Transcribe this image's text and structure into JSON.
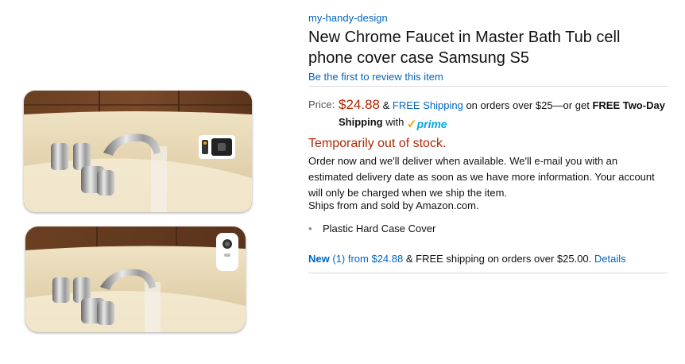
{
  "product": {
    "brand": "my-handy-design",
    "title": "New Chrome Faucet in Master Bath Tub cell phone cover case Samsung S5",
    "review_link": "Be the first to review this item",
    "images": [
      {
        "name": "samsung-s5-case-image"
      },
      {
        "name": "iphone-case-image"
      }
    ]
  },
  "price": {
    "label": "Price:",
    "amount": "$24.88",
    "amp": "&",
    "free_shipping_link": "FREE Shipping",
    "shipping_text": "on orders over $25—or get",
    "two_day": "FREE Two-Day Shipping",
    "with": "with",
    "prime_check": "✓",
    "prime_word": "prime"
  },
  "availability": {
    "status": "Temporarily out of stock.",
    "details": "Order now and we'll deliver when available. We'll e-mail you with an estimated delivery date as soon as we have more information. Your account will only be charged when we ship the item.",
    "ships_from": "Ships from and sold by Amazon.com."
  },
  "features": [
    "Plastic Hard Case Cover"
  ],
  "offers": {
    "new_label": "New",
    "count_price": "(1) from $24.88",
    "shipping": "& FREE shipping on orders over $25.00.",
    "details_link": "Details"
  },
  "colors": {
    "link": "#0066c0",
    "price": "#b12704",
    "prime_check": "#f7a300",
    "prime_word": "#00a8e1"
  }
}
